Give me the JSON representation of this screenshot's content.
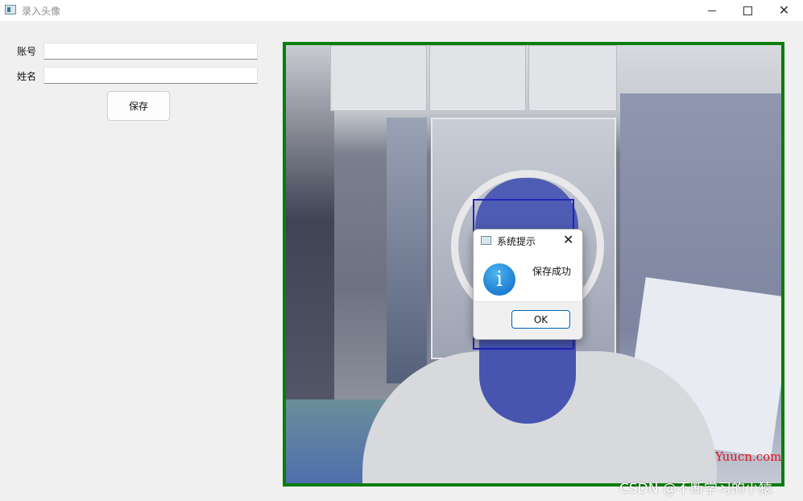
{
  "window": {
    "title": "录入头像",
    "icon": "app-window-icon"
  },
  "form": {
    "account_label": "账号",
    "account_value": "",
    "name_label": "姓名",
    "name_value": "",
    "save_label": "保存"
  },
  "camera": {
    "border_color": "#0a7d0a",
    "face_box_color": "#2323b8"
  },
  "dialog": {
    "title": "系统提示",
    "message": "保存成功",
    "icon": "info-icon",
    "ok_label": "OK"
  },
  "watermarks": {
    "site": "Yuucn.com",
    "csdn": "CSDN @不断学习的小猿"
  }
}
